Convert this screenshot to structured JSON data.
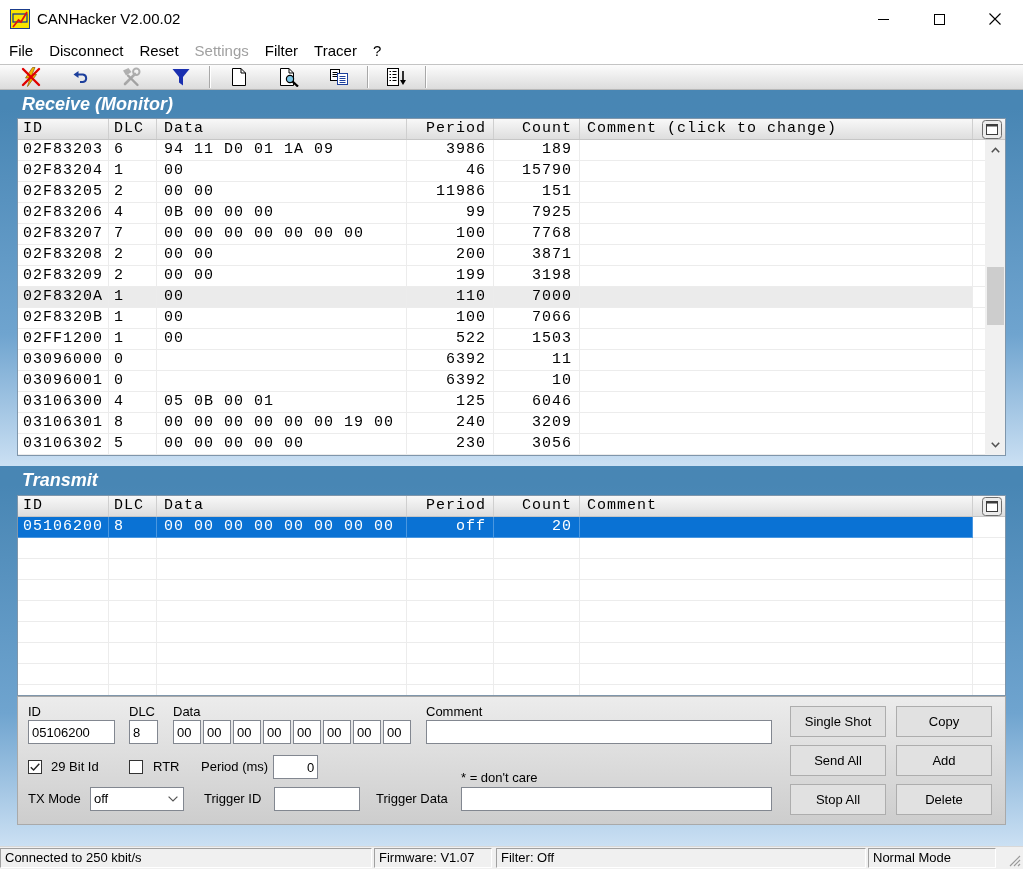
{
  "window": {
    "title": "CANHacker V2.00.02"
  },
  "menu": [
    {
      "label": "File",
      "disabled": false
    },
    {
      "label": "Disconnect",
      "disabled": false
    },
    {
      "label": "Reset",
      "disabled": false
    },
    {
      "label": "Settings",
      "disabled": true
    },
    {
      "label": "Filter",
      "disabled": false
    },
    {
      "label": "Tracer",
      "disabled": false
    },
    {
      "label": "?",
      "disabled": false
    }
  ],
  "toolbar": {
    "groups": [
      [
        {
          "disabled": false
        },
        {
          "disabled": false
        },
        {
          "disabled": true
        },
        {
          "disabled": false
        }
      ],
      [
        {
          "disabled": false
        },
        {
          "disabled": false
        },
        {
          "disabled": false
        }
      ],
      [
        {
          "disabled": false
        }
      ]
    ]
  },
  "receive": {
    "title": "Receive (Monitor)",
    "focused": false,
    "columns": [
      "ID",
      "DLC",
      "Data",
      "Period",
      "Count",
      "Comment (click to change)"
    ],
    "rows": [
      {
        "id": "02F83203",
        "dlc": "6",
        "data": "94 11 D0 01 1A 09",
        "period": "3986",
        "count": "189",
        "selected": false
      },
      {
        "id": "02F83204",
        "dlc": "1",
        "data": "00",
        "period": "46",
        "count": "15790",
        "selected": false
      },
      {
        "id": "02F83205",
        "dlc": "2",
        "data": "00 00",
        "period": "11986",
        "count": "151",
        "selected": false
      },
      {
        "id": "02F83206",
        "dlc": "4",
        "data": "0B 00 00 00",
        "period": "99",
        "count": "7925",
        "selected": false
      },
      {
        "id": "02F83207",
        "dlc": "7",
        "data": "00 00 00 00 00 00 00",
        "period": "100",
        "count": "7768",
        "selected": false
      },
      {
        "id": "02F83208",
        "dlc": "2",
        "data": "00 00",
        "period": "200",
        "count": "3871",
        "selected": false
      },
      {
        "id": "02F83209",
        "dlc": "2",
        "data": "00 00",
        "period": "199",
        "count": "3198",
        "selected": false
      },
      {
        "id": "02F8320A",
        "dlc": "1",
        "data": "00",
        "period": "110",
        "count": "7000",
        "selected": true
      },
      {
        "id": "02F8320B",
        "dlc": "1",
        "data": "00",
        "period": "100",
        "count": "7066",
        "selected": false
      },
      {
        "id": "02FF1200",
        "dlc": "1",
        "data": "00",
        "period": "522",
        "count": "1503",
        "selected": false
      },
      {
        "id": "03096000",
        "dlc": "0",
        "period": "6392",
        "count": "11",
        "selected": false
      },
      {
        "id": "03096001",
        "dlc": "0",
        "period": "6392",
        "count": "10",
        "selected": false
      },
      {
        "id": "03106300",
        "dlc": "4",
        "data": "05 0B 00 01",
        "period": "125",
        "count": "6046",
        "selected": false
      },
      {
        "id": "03106301",
        "dlc": "8",
        "data": "00 00 00 00 00 00 19 00",
        "period": "240",
        "count": "3209",
        "selected": false
      },
      {
        "id": "03106302",
        "dlc": "5",
        "data": "00 00 00 00 00",
        "period": "230",
        "count": "3056",
        "selected": false
      }
    ]
  },
  "transmit": {
    "title": "Transmit",
    "focused": true,
    "columns": [
      "ID",
      "DLC",
      "Data",
      "Period",
      "Count",
      "Comment"
    ],
    "rows": [
      {
        "id": "05106200",
        "dlc": "8",
        "data": "00 00 00 00 00 00 00 00",
        "period": "off",
        "count": "20",
        "selected": true
      }
    ]
  },
  "form": {
    "id": {
      "label": "ID",
      "value": "05106200"
    },
    "dlc": {
      "label": "DLC",
      "value": "8"
    },
    "data": {
      "label": "Data",
      "bytes": [
        "00",
        "00",
        "00",
        "00",
        "00",
        "00",
        "00",
        "00"
      ]
    },
    "comment": {
      "label": "Comment"
    },
    "extended_id": {
      "label": "29 Bit Id",
      "checked": true
    },
    "rtr": {
      "label": "RTR",
      "checked": false
    },
    "period": {
      "label": "Period (ms)",
      "value": "0"
    },
    "hint": "* = don't care",
    "tx_mode": {
      "label": "TX Mode",
      "value": "off"
    },
    "trigger_id": {
      "label": "Trigger ID"
    },
    "trigger_data": {
      "label": "Trigger Data"
    },
    "buttons": [
      "Single Shot",
      "Copy",
      "Send All",
      "Add",
      "Stop All",
      "Delete"
    ]
  },
  "status_bar": [
    "Connected to 250 kbit/s",
    "Firmware: V1.07",
    "Filter: Off",
    "Normal Mode"
  ]
}
